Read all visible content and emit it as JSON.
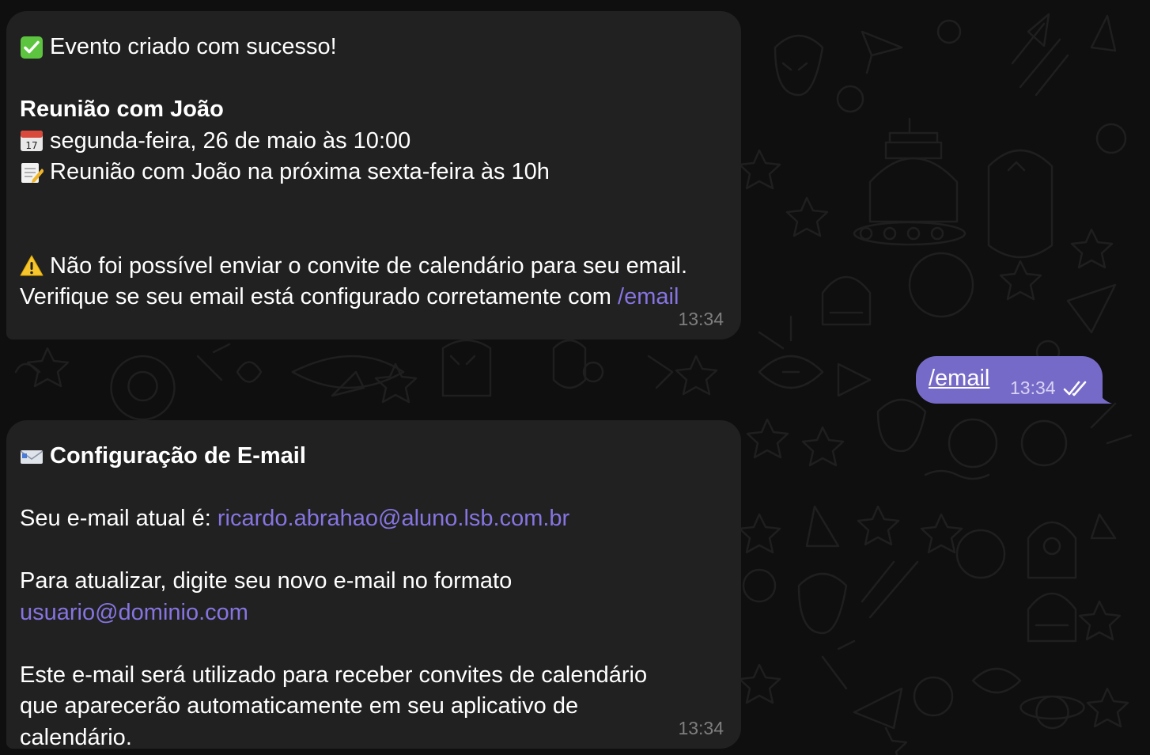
{
  "messages": {
    "event_created": {
      "status_icon": "check-mark-icon",
      "status_text": "Evento criado com sucesso!",
      "title": "Reunião com João",
      "date_icon": "calendar-icon",
      "date_text": "segunda-feira, 26 de maio às 10:00",
      "memo_icon": "memo-icon",
      "memo_text": "Reunião com João na próxima sexta-feira às 10h",
      "warning_icon": "warning-icon",
      "warning_text": "Não foi possível enviar o convite de calendário para seu email.",
      "verify_text": "Verifique se seu email está configurado corretamente com",
      "verify_link": "/email",
      "time": "13:34"
    },
    "outgoing": {
      "command": "/email",
      "time": "13:34",
      "status_icon": "double-check-icon"
    },
    "email_config": {
      "title_icon": "envelope-icon",
      "title": "Configuração de E-mail",
      "current_label": "Seu e-mail atual é:",
      "current_email": "ricardo.abrahao@aluno.lsb.com.br",
      "update_text": "Para atualizar, digite seu novo e-mail no formato",
      "format_example": "usuario@dominio.com",
      "info_line1": "Este e-mail será utilizado para receber convites de calendário",
      "info_line2": "que aparecerão automaticamente em seu aplicativo de",
      "info_line3": "calendário.",
      "time": "13:34"
    }
  },
  "colors": {
    "background": "#0f0f0f",
    "incoming_bubble": "#212121",
    "outgoing_bubble": "#766ac8",
    "link": "#8774e1",
    "timestamp": "#7e7e7e"
  }
}
